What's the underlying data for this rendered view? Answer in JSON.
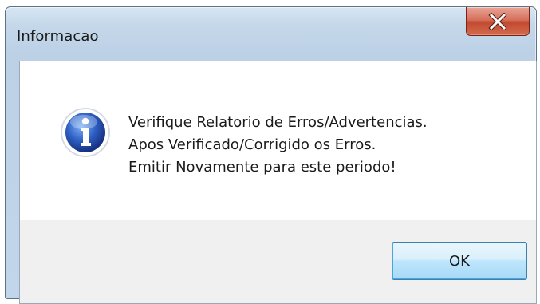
{
  "window": {
    "title": "Informacao"
  },
  "message": {
    "icon": "information-icon",
    "lines": [
      "Verifique Relatorio de Erros/Advertencias.",
      "Apos Verificado/Corrigido os Erros.",
      "Emitir Novamente para este periodo!"
    ]
  },
  "buttons": {
    "ok_label": "OK"
  },
  "colors": {
    "close_button": "#c24a30",
    "info_icon": "#2a56b8",
    "ok_border": "#3c7fb1"
  }
}
